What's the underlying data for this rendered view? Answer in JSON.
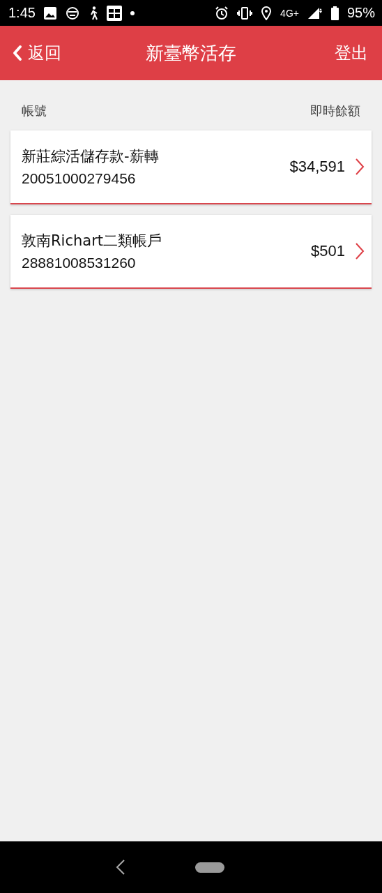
{
  "status_bar": {
    "time": "1:45",
    "network": "4G+",
    "battery": "95%"
  },
  "header": {
    "back": "返回",
    "title": "新臺幣活存",
    "logout": "登出"
  },
  "columns": {
    "account": "帳號",
    "balance": "即時餘額"
  },
  "accounts": [
    {
      "name": "新莊綜活儲存款-薪轉",
      "number": "20051000279456",
      "balance": "$34,591"
    },
    {
      "name": "敦南Richart二類帳戶",
      "number": "28881008531260",
      "balance": "$501"
    }
  ]
}
